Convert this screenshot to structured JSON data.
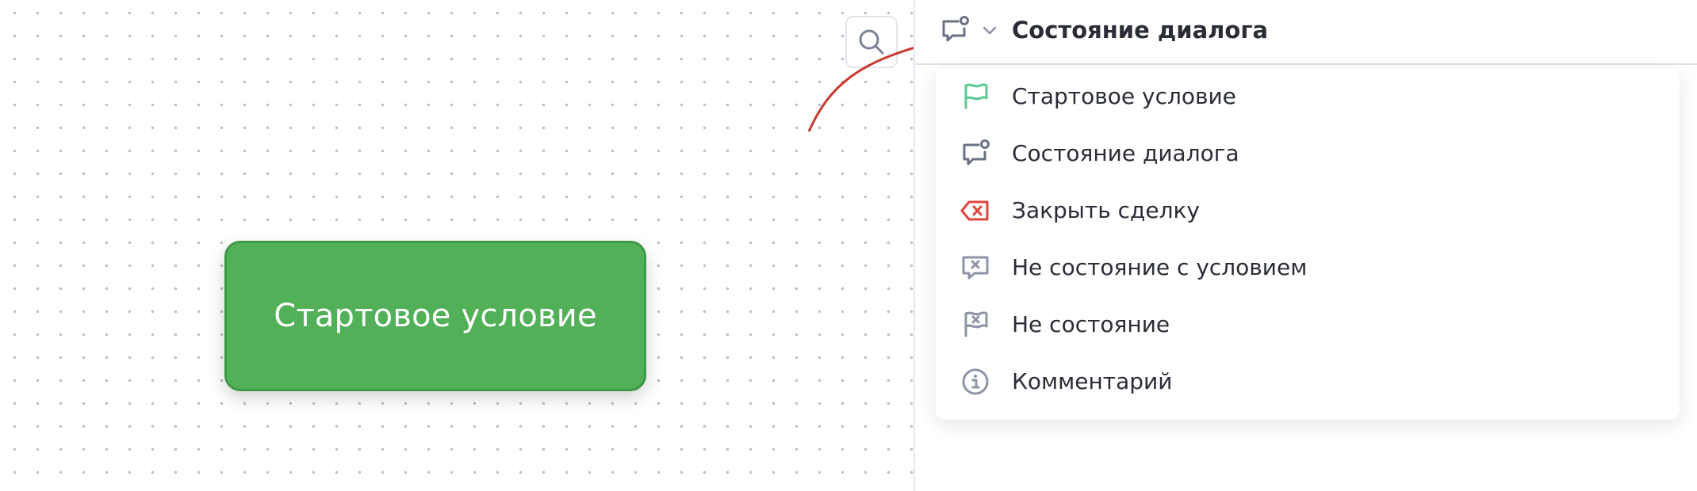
{
  "canvas": {
    "start_node_label": "Стартовое условие"
  },
  "panel": {
    "header_title": "Состояние диалога",
    "header_icon": "chat-status-icon",
    "menu_items": [
      {
        "label": "Стартовое условие",
        "icon": "flag-icon",
        "color": "#5cc98f"
      },
      {
        "label": "Состояние диалога",
        "icon": "chat-status-icon",
        "color": "#6b7185"
      },
      {
        "label": "Закрыть сделку",
        "icon": "backspace-close-icon",
        "color": "#e0463f"
      },
      {
        "label": "Не состояние с условием",
        "icon": "chat-x-icon",
        "color": "#8e94a6"
      },
      {
        "label": "Не состояние",
        "icon": "flag-x-icon",
        "color": "#8e94a6"
      },
      {
        "label": "Комментарий",
        "icon": "info-icon",
        "color": "#8e94a6"
      }
    ]
  },
  "colors": {
    "node_green": "#52b058",
    "arrow_red": "#c9392e"
  }
}
